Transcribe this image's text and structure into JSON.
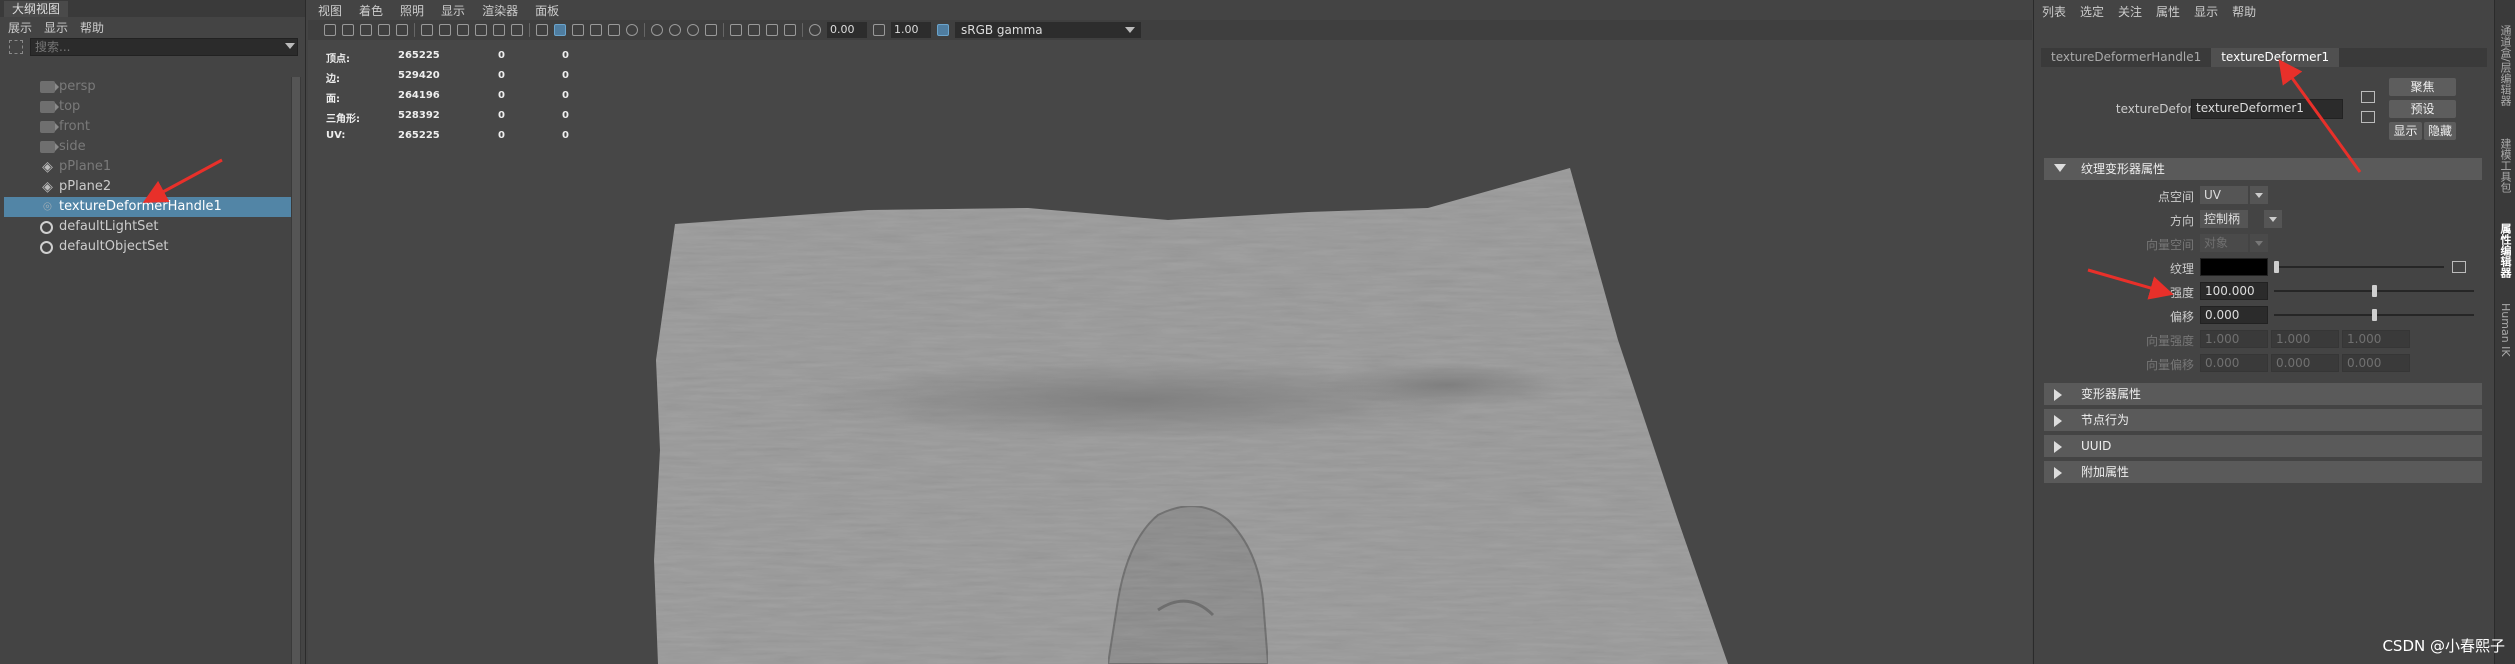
{
  "outliner": {
    "tab_title": "大纲视图",
    "menu": [
      "展示",
      "显示",
      "帮助"
    ],
    "search_placeholder": "搜索...",
    "items": [
      {
        "label": "persp",
        "icon": "camera-icon",
        "dim": true
      },
      {
        "label": "top",
        "icon": "camera-icon",
        "dim": true
      },
      {
        "label": "front",
        "icon": "camera-icon",
        "dim": true
      },
      {
        "label": "side",
        "icon": "camera-icon",
        "dim": true
      },
      {
        "label": "pPlane1",
        "icon": "mesh-icon",
        "dim": true
      },
      {
        "label": "pPlane2",
        "icon": "mesh-icon",
        "dim": false
      },
      {
        "label": "textureDeformerHandle1",
        "icon": "deformer-handle-icon",
        "dim": false,
        "selected": true
      },
      {
        "label": "defaultLightSet",
        "icon": "set-icon",
        "dim": false
      },
      {
        "label": "defaultObjectSet",
        "icon": "set-icon",
        "dim": false
      }
    ]
  },
  "viewport": {
    "menu": [
      "视图",
      "着色",
      "照明",
      "显示",
      "渲染器",
      "面板"
    ],
    "exposure": "0.00",
    "gamma": "1.00",
    "color_space": "sRGB gamma",
    "hud": [
      {
        "label": "顶点:",
        "v1": "265225",
        "v2": "0",
        "v3": "0"
      },
      {
        "label": "边:",
        "v1": "529420",
        "v2": "0",
        "v3": "0"
      },
      {
        "label": "面:",
        "v1": "264196",
        "v2": "0",
        "v3": "0"
      },
      {
        "label": "三角形:",
        "v1": "528392",
        "v2": "0",
        "v3": "0"
      },
      {
        "label": "UV:",
        "v1": "265225",
        "v2": "0",
        "v3": "0"
      }
    ],
    "colors": {
      "background": "#474747",
      "mesh": "#a3a3a3",
      "mesh_shadow": "#8e8e8e"
    }
  },
  "attr": {
    "menu": [
      "列表",
      "选定",
      "关注",
      "属性",
      "显示",
      "帮助"
    ],
    "tabs": [
      "textureDeformerHandle1",
      "textureDeformer1"
    ],
    "active_tab": 1,
    "node_label": "textureDeformer:",
    "node_value": "textureDeformer1",
    "focus_button": "聚焦",
    "presets_button": "预设",
    "show_button": "显示",
    "hide_button": "隐藏",
    "section_main": "纹理变形器属性",
    "point_space_label": "点空间",
    "point_space_value": "UV",
    "direction_label": "方向",
    "direction_value": "控制柄",
    "vector_space_label": "向量空间",
    "vector_space_value": "对象",
    "texture_label": "纹理",
    "strength_label": "强度",
    "strength_value": "100.000",
    "offset_label": "偏移",
    "offset_value": "0.000",
    "vector_strength_label": "向量强度",
    "vector_strength": [
      "1.000",
      "1.000",
      "1.000"
    ],
    "vector_offset_label": "向量偏移",
    "vector_offset": [
      "0.000",
      "0.000",
      "0.000"
    ],
    "collapsed_sections": [
      "变形器属性",
      "节点行为",
      "UUID",
      "附加属性"
    ],
    "strength_slider": 0.5,
    "offset_slider": 0.5
  },
  "side_tabs": [
    "通道盒/层编辑器",
    "建模工具包",
    "属性编辑器",
    "Human IK"
  ],
  "side_tab_active": 2,
  "watermark": "CSDN @小春熙子",
  "annotation_color": "#e8302a"
}
